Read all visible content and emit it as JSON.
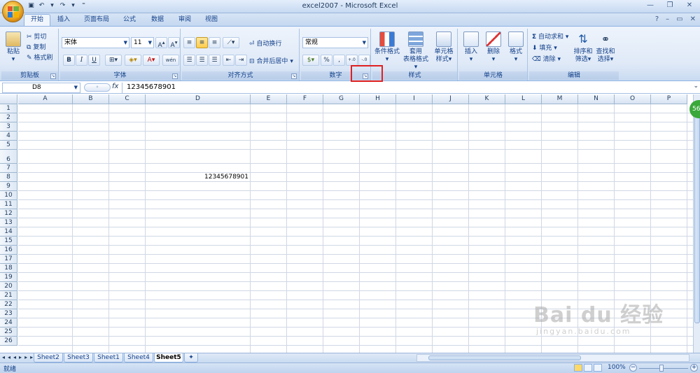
{
  "title": "excel2007 - Microsoft Excel",
  "tabs": [
    "开始",
    "插入",
    "页面布局",
    "公式",
    "数据",
    "审阅",
    "视图"
  ],
  "ribbon": {
    "clipboard": {
      "paste": "粘贴",
      "cut": "剪切",
      "copy": "复制",
      "format_painter": "格式刷",
      "group_label": "剪贴板"
    },
    "font": {
      "name": "宋体",
      "size": "11",
      "bold": "B",
      "italic": "I",
      "underline": "U",
      "wen": "wén",
      "group_label": "字体"
    },
    "alignment": {
      "wrap_text": "自动换行",
      "merge_center": "合并后居中",
      "group_label": "对齐方式"
    },
    "number": {
      "format": "常规",
      "percent": "%",
      "comma": ",",
      "inc": ".0 .00",
      "dec": ".00 .0",
      "group_label": "数字"
    },
    "styles": {
      "conditional_format": "条件格式",
      "table_format_1": "套用",
      "table_format_2": "表格格式",
      "cell_style_1": "单元格",
      "cell_style_2": "样式",
      "group_label": "样式"
    },
    "cells": {
      "insert": "插入",
      "delete": "删除",
      "format": "格式",
      "group_label": "单元格"
    },
    "editing": {
      "autosum": "自动求和",
      "fill": "填充",
      "clear": "清除",
      "sort_1": "排序和",
      "sort_2": "筛选",
      "find_1": "查找和",
      "find_2": "选择",
      "group_label": "编辑"
    }
  },
  "formula_bar": {
    "name_box": "D8",
    "fx": "fx",
    "value": "12345678901"
  },
  "columns": [
    "A",
    "B",
    "C",
    "D",
    "E",
    "F",
    "G",
    "H",
    "I",
    "J",
    "K",
    "L",
    "M",
    "N",
    "O",
    "P"
  ],
  "rows": [
    "1",
    "2",
    "3",
    "4",
    "5",
    "6",
    "7",
    "8",
    "9",
    "10",
    "11",
    "12",
    "13",
    "14",
    "15",
    "16",
    "17",
    "18",
    "19",
    "20",
    "21",
    "22",
    "23",
    "24",
    "25",
    "26"
  ],
  "cell_d8": "12345678901",
  "sheets": [
    "Sheet2",
    "Sheet3",
    "Sheet1",
    "Sheet4",
    "Sheet5"
  ],
  "active_sheet": "Sheet5",
  "status": {
    "ready": "就绪",
    "zoom": "100%"
  },
  "badge": "56",
  "watermark": {
    "main": "Bai du 经验",
    "sub": "jingyan.baidu.com"
  },
  "colors": {
    "accent": "#15428b",
    "ribbon_bg": "#dfe9f7",
    "highlight_box": "#e02020"
  }
}
